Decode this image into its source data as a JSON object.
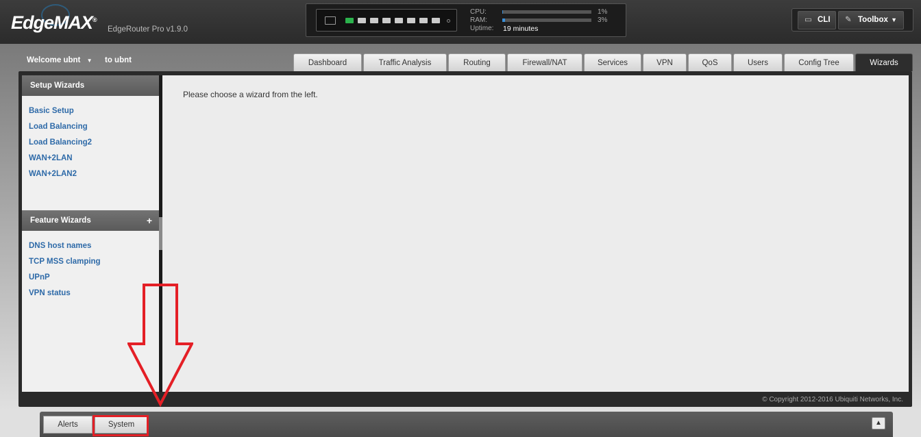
{
  "header": {
    "brand": "EdgeMAX",
    "brand_mark": "®",
    "model": "EdgeRouter Pro v1.9.0",
    "cpu_label": "CPU:",
    "cpu_value": "1%",
    "cpu_fraction": 0.01,
    "ram_label": "RAM:",
    "ram_value": "3%",
    "ram_fraction": 0.03,
    "uptime_label": "Uptime:",
    "uptime_value": "19 minutes",
    "cli_label": "CLI",
    "toolbox_label": "Toolbox",
    "cli_icon": "terminal-icon",
    "toolbox_icon": "wrench-icon"
  },
  "user": {
    "welcome": "Welcome ubnt",
    "to_label": "to ubnt"
  },
  "tabs": [
    {
      "label": "Dashboard"
    },
    {
      "label": "Traffic Analysis"
    },
    {
      "label": "Routing"
    },
    {
      "label": "Firewall/NAT"
    },
    {
      "label": "Services"
    },
    {
      "label": "VPN"
    },
    {
      "label": "QoS"
    },
    {
      "label": "Users"
    },
    {
      "label": "Config Tree"
    },
    {
      "label": "Wizards"
    }
  ],
  "active_tab": "Wizards",
  "sidebar": {
    "setup_title": "Setup Wizards",
    "setup_items": [
      "Basic Setup",
      "Load Balancing",
      "Load Balancing2",
      "WAN+2LAN",
      "WAN+2LAN2"
    ],
    "feature_title": "Feature Wizards",
    "feature_expand": "+",
    "feature_items": [
      "DNS host names",
      "TCP MSS clamping",
      "UPnP",
      "VPN status"
    ]
  },
  "main": {
    "message": "Please choose a wizard from the left."
  },
  "footer": {
    "copyright": "© Copyright 2012-2016 Ubiquiti Networks, Inc."
  },
  "bottom": {
    "alerts_label": "Alerts",
    "system_label": "System",
    "collapse_icon": "chevron-up-icon"
  },
  "annotation": {
    "color": "#e41f26"
  }
}
